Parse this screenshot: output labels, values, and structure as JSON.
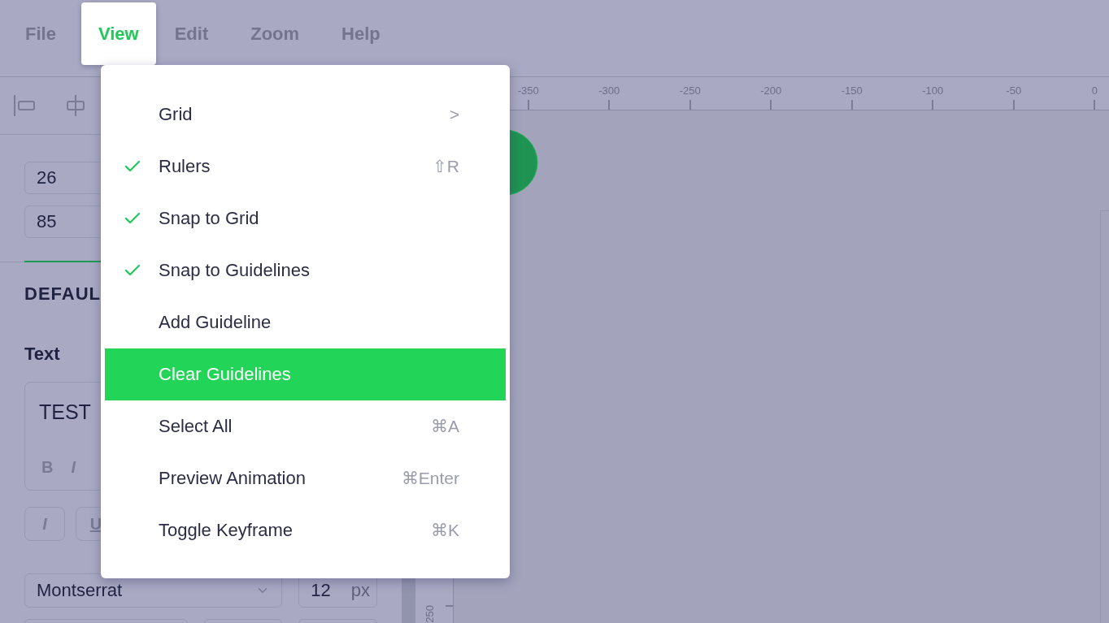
{
  "menubar": [
    {
      "label": "File",
      "selected": false
    },
    {
      "label": "View",
      "selected": true
    },
    {
      "label": "Edit",
      "selected": false
    },
    {
      "label": "Zoom",
      "selected": false
    },
    {
      "label": "Help",
      "selected": false
    }
  ],
  "view_menu": [
    {
      "label": "Grid",
      "shortcut": ">",
      "checked": false,
      "selected": false
    },
    {
      "label": "Rulers",
      "shortcut": "⇧R",
      "checked": true,
      "selected": false
    },
    {
      "label": "Snap to Grid",
      "checked": true,
      "selected": false
    },
    {
      "label": "Snap to Guidelines",
      "checked": true,
      "selected": false
    },
    {
      "label": "Add Guideline",
      "checked": false,
      "selected": false
    },
    {
      "label": "Clear Guidelines",
      "checked": false,
      "selected": true
    },
    {
      "label": "Select All",
      "shortcut": "⌘A",
      "checked": false,
      "selected": false
    },
    {
      "label": "Preview Animation",
      "shortcut": "⌘Enter",
      "checked": false,
      "selected": false
    },
    {
      "label": "Toggle Keyframe",
      "shortcut": "⌘K",
      "checked": false,
      "selected": false
    }
  ],
  "sidebar": {
    "fields": [
      "26",
      "85"
    ],
    "section_title": "DEFAUL",
    "text_label": "Text",
    "text_value": "TEST",
    "format_buttons": [
      "B",
      "I"
    ],
    "style_buttons": [
      "I",
      "U"
    ],
    "font": "Montserrat",
    "font_size": "12",
    "font_size_unit": "px"
  },
  "ruler": {
    "top_labels": [
      "-350",
      "-300",
      "-250",
      "-200",
      "-150",
      "-100",
      "-50",
      "0"
    ],
    "side_labels": [
      "250"
    ]
  }
}
